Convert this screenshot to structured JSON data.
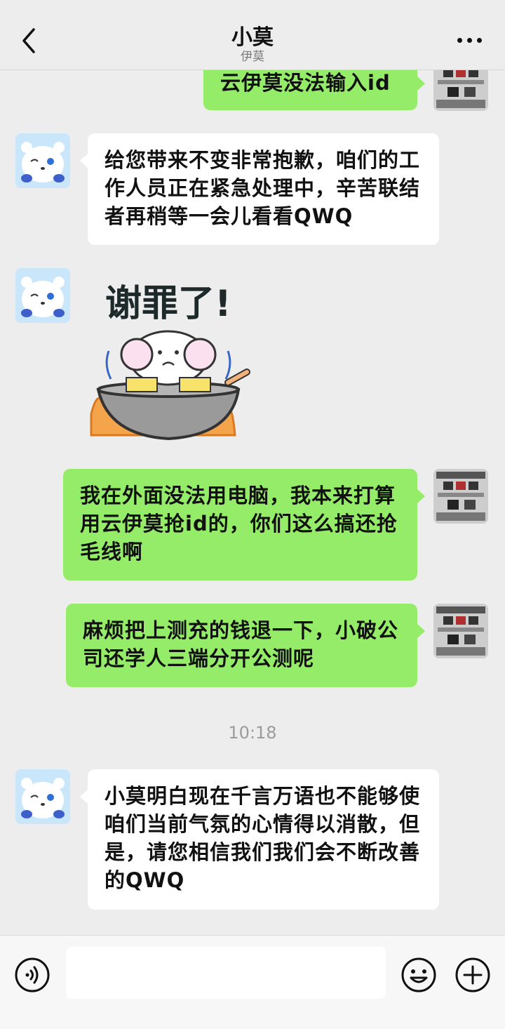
{
  "header": {
    "title": "小莫",
    "subtitle": "伊莫",
    "back_icon": "chevron-left-icon",
    "more_icon": "more-dots-icon"
  },
  "messages": [
    {
      "side": "right",
      "text": "云伊莫没法输入id"
    },
    {
      "side": "left",
      "text": "给您带来不变非常抱歉，咱们的工作人员正在紧急处理中，辛苦联结者再稍等一会儿看看QWQ"
    },
    {
      "side": "left",
      "type": "sticker",
      "sticker_text": "谢罪了!"
    },
    {
      "side": "right",
      "text": "我在外面没法用电脑，我本来打算用云伊莫抢id的，你们这么搞还抢毛线啊"
    },
    {
      "side": "right",
      "text": "麻烦把上测充的钱退一下，小破公司还学人三端分开公测呢"
    },
    {
      "side": "left",
      "text": "小莫明白现在千言万语也不能够使咱们当前气氛的心情得以消散，但是，请您相信我们我们会不断改善的QWQ"
    }
  ],
  "timestamp": "10:18",
  "input_bar": {
    "voice_icon": "voice-icon",
    "emoji_icon": "emoji-icon",
    "plus_icon": "plus-icon",
    "text_value": ""
  },
  "colors": {
    "background": "#ededed",
    "bubble_self": "#95ec69",
    "bubble_other": "#ffffff"
  }
}
